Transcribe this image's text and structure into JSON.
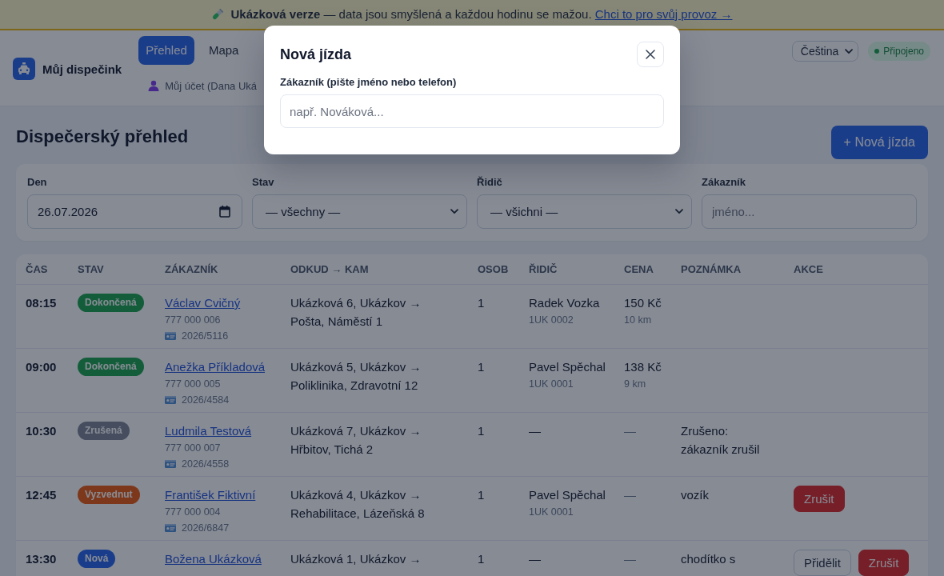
{
  "banner": {
    "text": "**Ukázková verze** — data jsou smyšlená a každou hodinu se mažou.",
    "link": "Chci to pro svůj provoz →"
  },
  "header": {
    "brand": "Můj dispečink",
    "nav": [
      {
        "label": "Přehled",
        "selected": true
      },
      {
        "label": "Mapa",
        "selected": false
      }
    ],
    "account": "Můj účet (Dana Uká",
    "language": "Čeština",
    "connection": {
      "label": "Připojeno",
      "online": true
    }
  },
  "page": {
    "title": "Dispečerský přehled",
    "new_ride_button": "+ Nová jízda"
  },
  "filters": [
    {
      "kind": "date",
      "label": "Den",
      "value": "26.07.2026"
    },
    {
      "kind": "select",
      "label": "Stav",
      "value": "— všechny —"
    },
    {
      "kind": "select",
      "label": "Řidič",
      "value": "— všichni —"
    },
    {
      "kind": "text",
      "label": "Zákazník",
      "placeholder": "jméno..."
    }
  ],
  "table": {
    "columns": [
      "ČAS",
      "STAV",
      "ZÁKAZNÍK",
      "ODKUD → KAM",
      "OSOB",
      "ŘIDIČ",
      "CENA",
      "POZNÁMKA",
      "AKCE"
    ],
    "rows": [
      {
        "time": "08:15",
        "status": {
          "label": "Dokončená",
          "color": "#135d3a"
        },
        "customer": {
          "name": "Václav Cvičný",
          "phone": "777 000 006",
          "card": "2026/5116"
        },
        "route": "Ukázková 6, Ukázkov → Pošta, Náměstí 1",
        "persons": "1",
        "driver": {
          "name": "Radek Vozka",
          "plate": "1UK 0002"
        },
        "price": {
          "amount": "150 Kč",
          "distance": "10 km",
          "muted": false
        }
      },
      {
        "time": "09:00",
        "status": {
          "label": "Dokončená",
          "color": "#135d3a"
        },
        "customer": {
          "name": "Anežka Příkladová",
          "phone": "777 000 005",
          "card": "2026/4584"
        },
        "route": "Ukázková 5, Ukázkov → Poliklinika, Zdravotní 12",
        "persons": "1",
        "driver": {
          "name": "Pavel Spěchal",
          "plate": "1UK 0001"
        },
        "price": {
          "amount": "138 Kč",
          "distance": "9 km",
          "muted": false
        }
      },
      {
        "time": "10:30",
        "status": {
          "label": "Zrušená",
          "color": "#454d5f"
        },
        "customer": {
          "name": "Ludmila Testová",
          "phone": "777 000 007",
          "card": "2026/4558"
        },
        "route": "Ukázková 7, Ukázkov → Hřbitov, Tichá 2",
        "persons": "1",
        "driver": {
          "name": "—"
        },
        "price": {
          "amount": "—",
          "muted": true
        },
        "note": "Zrušeno: zákazník zrušil"
      },
      {
        "time": "12:45",
        "status": {
          "label": "Vyzvednut",
          "color": "#7d381b"
        },
        "customer": {
          "name": "František Fiktivní",
          "phone": "777 000 004",
          "card": "2026/6847"
        },
        "route": "Ukázková 4, Ukázkov → Rehabilitace, Lázeňská 8",
        "persons": "1",
        "driver": {
          "name": "Pavel Spěchal",
          "plate": "1UK 0001"
        },
        "price": {
          "amount": "—",
          "muted": true
        },
        "note": "vozík",
        "actions": [
          {
            "kind": "cancel",
            "label": "Zrušit"
          }
        ]
      },
      {
        "time": "13:30",
        "status": {
          "label": "Nová",
          "color": "#1a3d8b"
        },
        "customer": {
          "name": "Božena Ukázková"
        },
        "route": "Ukázková 1, Ukázkov →",
        "persons": "1",
        "driver": {
          "name": "—"
        },
        "price": {
          "amount": "—",
          "muted": true
        },
        "note": "chodítko s",
        "actions": [
          {
            "kind": "assign",
            "label": "Přidělit"
          },
          {
            "kind": "cancel",
            "label": "Zrušit"
          }
        ]
      }
    ]
  },
  "modal": {
    "title": "Nová jízda",
    "field": {
      "label": "Zákazník (pište jméno nebo telefon)",
      "placeholder": "např. Nováková..."
    }
  }
}
